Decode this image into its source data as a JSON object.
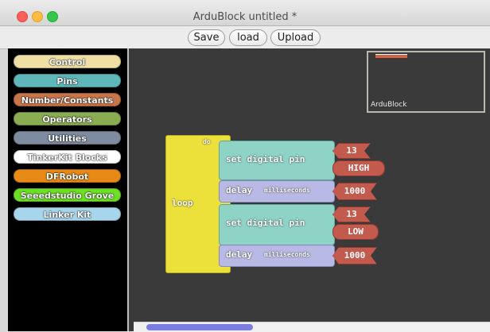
{
  "window": {
    "title": "ArduBlock untitled *"
  },
  "toolbar": {
    "save": "Save",
    "load": "load",
    "upload": "Upload"
  },
  "palette": {
    "categories": [
      {
        "label": "Control",
        "color": "#f0dfa4"
      },
      {
        "label": "Pins",
        "color": "#5fb7b9"
      },
      {
        "label": "Number/Constants",
        "color": "#c9754b"
      },
      {
        "label": "Operators",
        "color": "#8aac52"
      },
      {
        "label": "Utilities",
        "color": "#7d8c9f"
      },
      {
        "label": "TinkerKit Blocks",
        "color": "#ffffff"
      },
      {
        "label": "DFRobot",
        "color": "#e88a16"
      },
      {
        "label": "Seeedstudio Grove",
        "color": "#6ce024"
      },
      {
        "label": "Linker Kit",
        "color": "#a7d6ec"
      }
    ]
  },
  "minimap": {
    "label": "ArduBlock"
  },
  "program": {
    "loop": {
      "label": "loop",
      "do_label": "do"
    },
    "statements": [
      {
        "type": "set digital pin",
        "pin": "13",
        "value": "HIGH"
      },
      {
        "type": "delay",
        "unit": "milliseconds",
        "value": "1000"
      },
      {
        "type": "set digital pin",
        "pin": "13",
        "value": "LOW"
      },
      {
        "type": "delay",
        "unit": "milliseconds",
        "value": "1000"
      }
    ]
  }
}
